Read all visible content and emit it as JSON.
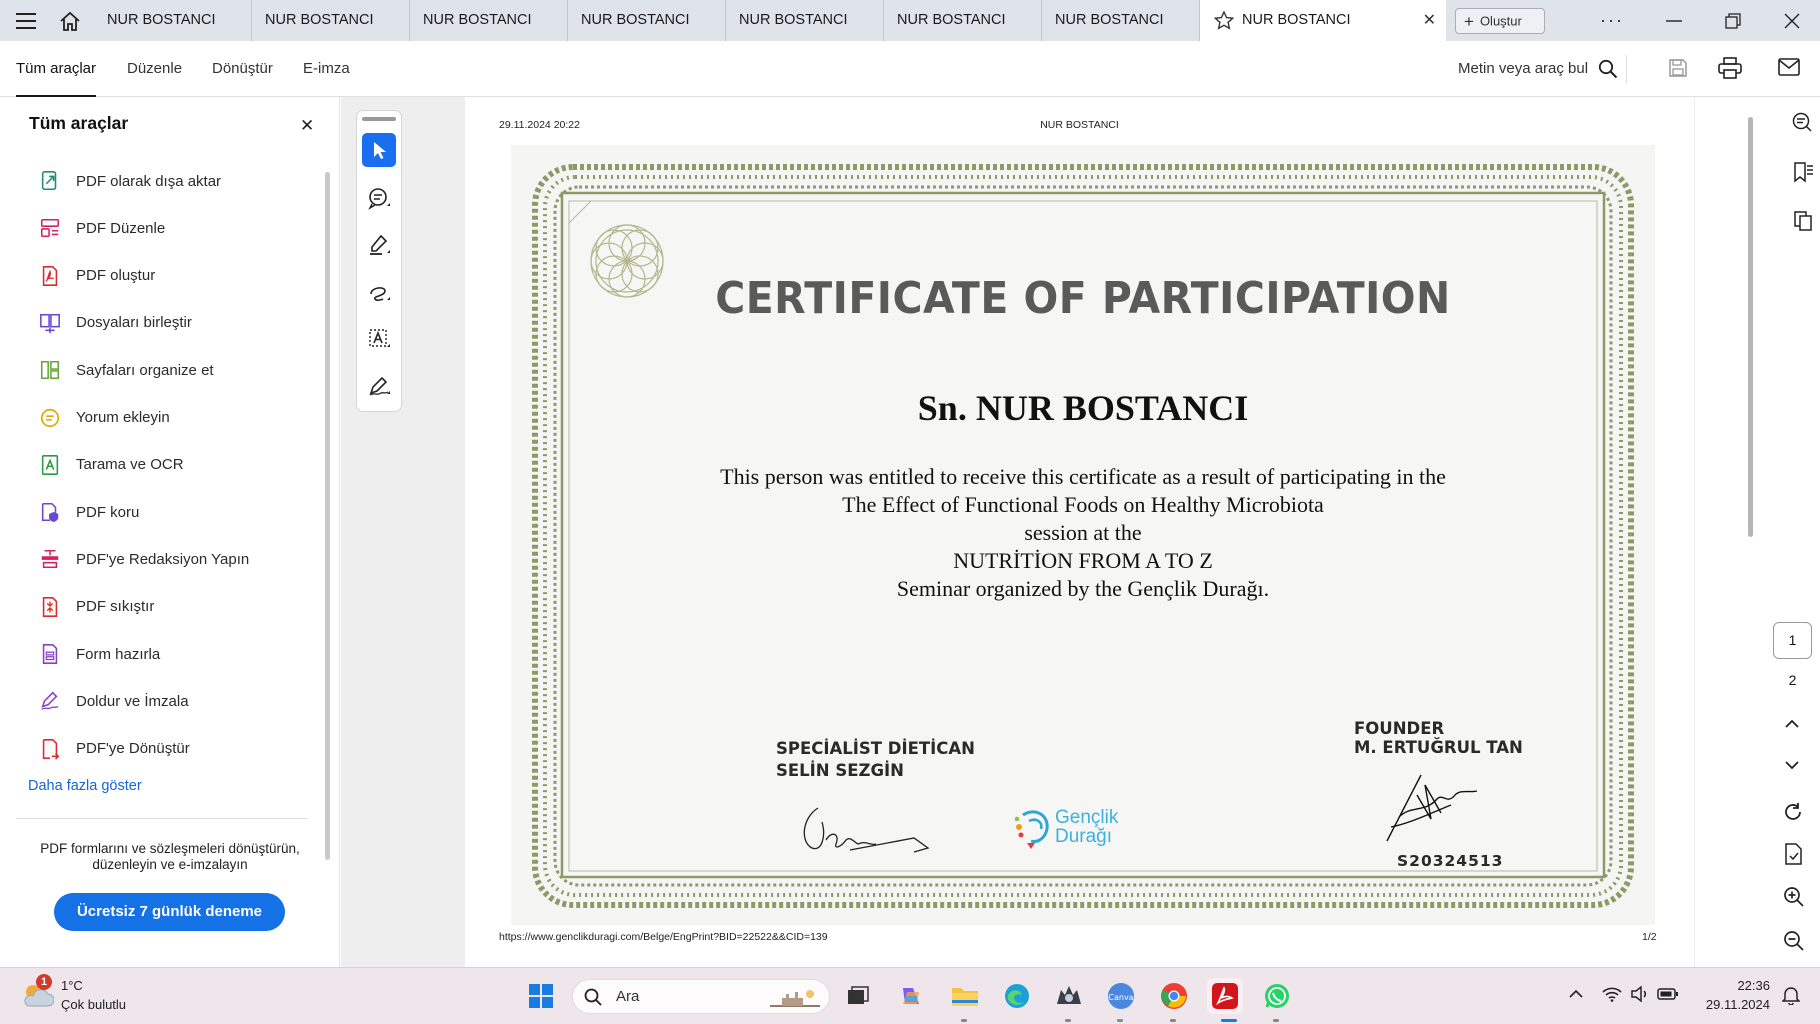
{
  "titlebar": {
    "tabs": [
      {
        "label": "NUR BOSTANCI"
      },
      {
        "label": "NUR BOSTANCI"
      },
      {
        "label": "NUR BOSTANCI"
      },
      {
        "label": "NUR BOSTANCI"
      },
      {
        "label": "NUR BOSTANCI"
      },
      {
        "label": "NUR BOSTANCI"
      },
      {
        "label": "NUR BOSTANCI"
      },
      {
        "label": "NUR BOSTANCI"
      }
    ],
    "create_label": "Oluştur"
  },
  "menubar": {
    "tabs": [
      {
        "label": "Tüm araçlar"
      },
      {
        "label": "Düzenle"
      },
      {
        "label": "Dönüştür"
      },
      {
        "label": "E-imza"
      }
    ],
    "search_label": "Metin veya araç bul"
  },
  "sidebar": {
    "title": "Tüm araçlar",
    "items": [
      {
        "label": "PDF olarak dışa aktar",
        "icon": "export-pdf-icon",
        "color": "#1d8f6e"
      },
      {
        "label": "PDF Düzenle",
        "icon": "edit-pdf-icon",
        "color": "#d6245b"
      },
      {
        "label": "PDF oluştur",
        "icon": "create-pdf-icon",
        "color": "#d92c2c"
      },
      {
        "label": "Dosyaları birleştir",
        "icon": "combine-files-icon",
        "color": "#6a47d6"
      },
      {
        "label": "Sayfaları organize et",
        "icon": "organize-pages-icon",
        "color": "#6aa53a"
      },
      {
        "label": "Yorum ekleyin",
        "icon": "comment-icon",
        "color": "#e0a800"
      },
      {
        "label": "Tarama ve OCR",
        "icon": "scan-ocr-icon",
        "color": "#2d9a42"
      },
      {
        "label": "PDF koru",
        "icon": "protect-pdf-icon",
        "color": "#6a47d6"
      },
      {
        "label": "PDF'ye Redaksiyon Yapın",
        "icon": "redact-icon",
        "color": "#d6245b"
      },
      {
        "label": "PDF sıkıştır",
        "icon": "compress-pdf-icon",
        "color": "#d92c2c"
      },
      {
        "label": "Form hazırla",
        "icon": "prepare-form-icon",
        "color": "#8a3fc7"
      },
      {
        "label": "Doldur ve İmzala",
        "icon": "fill-sign-icon",
        "color": "#8a3fc7"
      },
      {
        "label": "PDF'ye Dönüştür",
        "icon": "convert-pdf-icon",
        "color": "#d92c2c"
      }
    ],
    "more_label": "Daha fazla göster",
    "promo_text": "PDF formlarını ve sözleşmeleri dönüştürün, düzenleyin ve e-imzalayın",
    "trial_button": "Ücretsiz 7 günlük deneme"
  },
  "document": {
    "header_date": "29.11.2024 20:22",
    "header_title": "NUR BOSTANCI",
    "footer_url": "https://www.genclikduragi.com/Belge/EngPrint?BID=22522&&CID=139",
    "footer_page": "1/2",
    "certificate": {
      "title": "CERTIFICATE OF PARTICIPATION",
      "recipient": "Sn. NUR BOSTANCI",
      "body_lines": [
        "This person was entitled to receive this certificate as a result of participating in the",
        "The Effect of Functional Foods on Healthy Microbiota",
        "session at the",
        "NUTRİTİON FROM A TO Z",
        "Seminar organized by the Gençlik Durağı."
      ],
      "left_sig_role": "SPECİALİST DİETİCAN",
      "left_sig_name": "SELİN SEZGİN",
      "logo_line1": "Gençlik",
      "logo_line2": "Durağı",
      "right_sig_role": "FOUNDER",
      "right_sig_name": "M. ERTUĞRUL TAN",
      "serial": "S20324513"
    }
  },
  "pagenav": {
    "pages": [
      "1",
      "2"
    ]
  },
  "taskbar": {
    "weather_badge": "1",
    "weather_temp": "1°C",
    "weather_desc": "Çok bulutlu",
    "search_placeholder": "Ara",
    "time": "22:36",
    "date": "29.11.2024"
  }
}
